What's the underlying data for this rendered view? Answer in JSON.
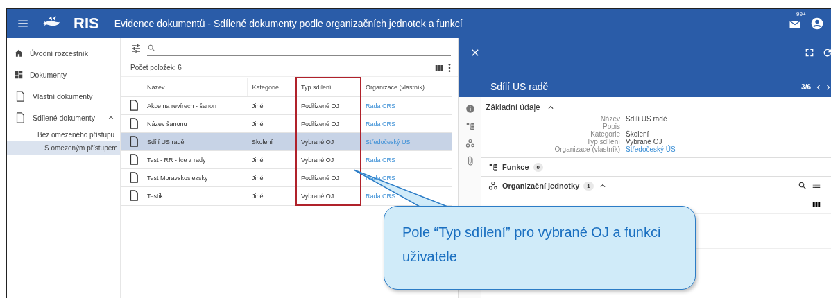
{
  "header": {
    "app_name": "RIS",
    "title": "Evidence dokumentů - Sdílené dokumenty podle organizačních jednotek a funkcí",
    "mail_badge": "99+"
  },
  "sidebar": {
    "items": [
      {
        "label": "Úvodní rozcestník",
        "kind": "home",
        "selected": false
      },
      {
        "label": "Dokumenty",
        "kind": "dashboard",
        "selected": false
      },
      {
        "label": "Vlastní dokumenty",
        "kind": "file",
        "selected": false
      },
      {
        "label": "Sdílené dokumenty",
        "kind": "file",
        "selected": false,
        "expanded": true,
        "children": [
          {
            "label": "Bez omezeného přístupu",
            "selected": false
          },
          {
            "label": "S omezeným přístupem",
            "selected": true
          }
        ]
      }
    ]
  },
  "list": {
    "count": "Počet položek: 6",
    "columns": [
      {
        "label": "Název",
        "highlighted": false
      },
      {
        "label": "Kategorie",
        "highlighted": false
      },
      {
        "label": "Typ sdílení",
        "highlighted": true
      },
      {
        "label": "Organizace (vlastník)",
        "highlighted": false
      }
    ],
    "rows": [
      {
        "cells": [
          "Akce na revírech - šanon",
          "Jiné",
          "Podřízené OJ",
          "Rada ČRS"
        ],
        "selected": false
      },
      {
        "cells": [
          "Název šanonu",
          "Jiné",
          "Podřízené OJ",
          "Rada ČRS"
        ],
        "selected": false
      },
      {
        "cells": [
          "Sdílí US radě",
          "Školení",
          "Vybrané OJ",
          "Středočeský ÚS"
        ],
        "selected": true
      },
      {
        "cells": [
          "Test - RR - fce z rady",
          "Jiné",
          "Vybrané OJ",
          "Rada ČRS"
        ],
        "selected": false
      },
      {
        "cells": [
          "Test Moravskoslezsky",
          "Jiné",
          "Podřízené OJ",
          "Rada ČRS"
        ],
        "selected": false
      },
      {
        "cells": [
          "Testik",
          "Jiné",
          "Vybrané OJ",
          "Rada ČRS"
        ],
        "selected": false
      }
    ]
  },
  "detail": {
    "title": "Sdílí US radě",
    "position": "3/6",
    "section": {
      "title": "Základní údaje",
      "expanded": true,
      "fields": [
        {
          "label": "Název",
          "value": "Sdílí US radě",
          "link": false
        },
        {
          "label": "Popis"
        },
        {
          "label": "Kategorie",
          "value": "Školení",
          "link": false
        },
        {
          "label": "Typ sdílení",
          "value": "Vybrané OJ",
          "link": false
        },
        {
          "label": "Organizace (vlastník)",
          "value": "Středočeský ÚS",
          "link": true
        }
      ]
    },
    "groups": [
      {
        "title": "Funkce",
        "count": "0",
        "kind": "functions",
        "expanded": false
      },
      {
        "title": "Organizační jednotky",
        "count": "1",
        "kind": "units",
        "expanded": true
      }
    ]
  },
  "callout": {
    "text": "Pole “Typ sdílení” pro vybrané OJ a funkci uživatele"
  }
}
